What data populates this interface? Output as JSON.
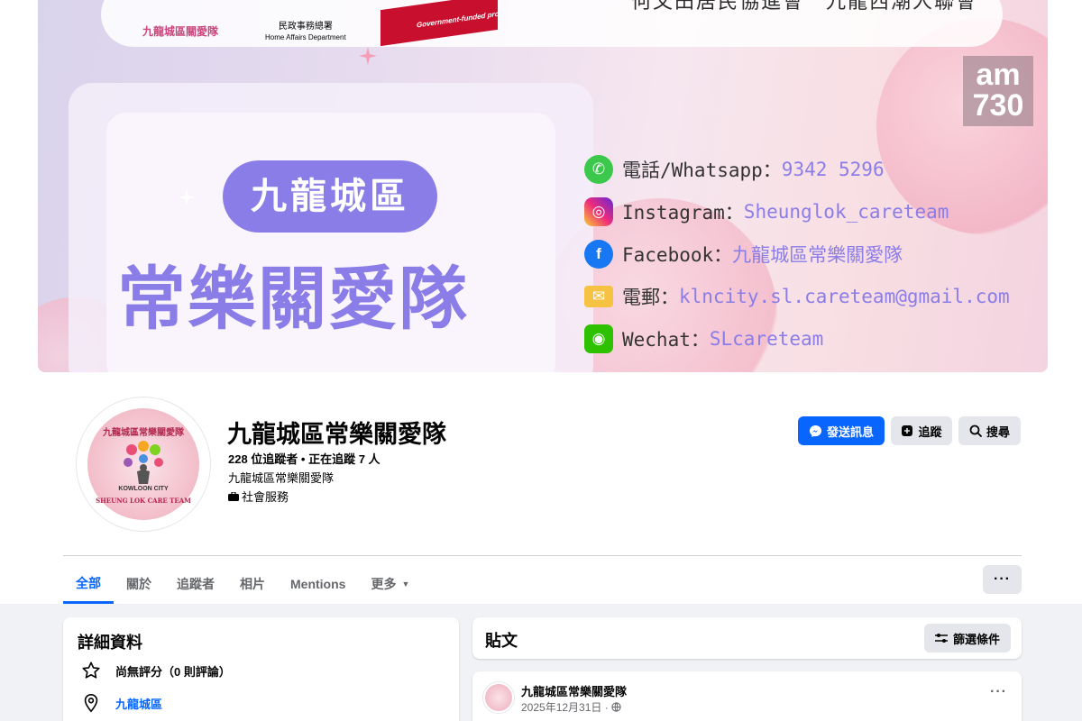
{
  "cover": {
    "logos": {
      "community_name": "九龍城區關愛隊",
      "home_affairs_cn": "民政事務總署",
      "home_affairs_en": "Home Affairs Department",
      "gov_programme": "Government-funded programme"
    },
    "org_names": "何文田居民協進會　九龍西潮人聯會",
    "pill_text": "九龍城區",
    "big_title": "常樂關愛隊",
    "contacts": [
      {
        "icon": "whatsapp-icon",
        "color": "#3cc84c",
        "label": "電話/Whatsapp：",
        "value": "9342 5296"
      },
      {
        "icon": "instagram-icon",
        "color": "#e1306c",
        "label": "Instagram：",
        "value": "Sheunglok_careteam"
      },
      {
        "icon": "facebook-icon",
        "color": "#1877f2",
        "label": "Facebook：",
        "value": "九龍城區常樂關愛隊"
      },
      {
        "icon": "email-icon",
        "color": "#f5c242",
        "label": "電郵：",
        "value": "klncity.sl.careteam@gmail.com"
      },
      {
        "icon": "wechat-icon",
        "color": "#2dc100",
        "label": "Wechat：",
        "value": "SLcareteam"
      }
    ],
    "watermark_top": "am",
    "watermark_bottom": "730"
  },
  "profile": {
    "avatar_text_top": "九龍城區常樂關愛隊",
    "avatar_text_mid": "KOWLOON CITY",
    "avatar_text_bottom": "SHEUNG LOK CARE TEAM",
    "name": "九龍城區常樂關愛隊",
    "followers": "228 位追蹤者 • 正在追蹤 7 人",
    "subtitle": "九龍城區常樂關愛隊",
    "category": "社會服務"
  },
  "actions": {
    "message": "發送訊息",
    "follow": "追蹤",
    "search": "搜尋"
  },
  "tabs": [
    {
      "label": "全部",
      "active": true
    },
    {
      "label": "關於",
      "active": false
    },
    {
      "label": "追蹤者",
      "active": false
    },
    {
      "label": "相片",
      "active": false
    },
    {
      "label": "Mentions",
      "active": false
    },
    {
      "label": "更多",
      "active": false
    }
  ],
  "more_dots": "···",
  "details": {
    "title": "詳細資料",
    "rating": "尚無評分（0 則評論）",
    "location": "九龍城區"
  },
  "posts": {
    "title": "貼文",
    "filter_label": "篩選條件",
    "first_post": {
      "author": "九龍城區常樂關愛隊",
      "date": "2025年12月31日 ·",
      "more": "···"
    }
  },
  "colors": {
    "accent": "#0866ff",
    "cover_purple": "#8b7de8"
  }
}
